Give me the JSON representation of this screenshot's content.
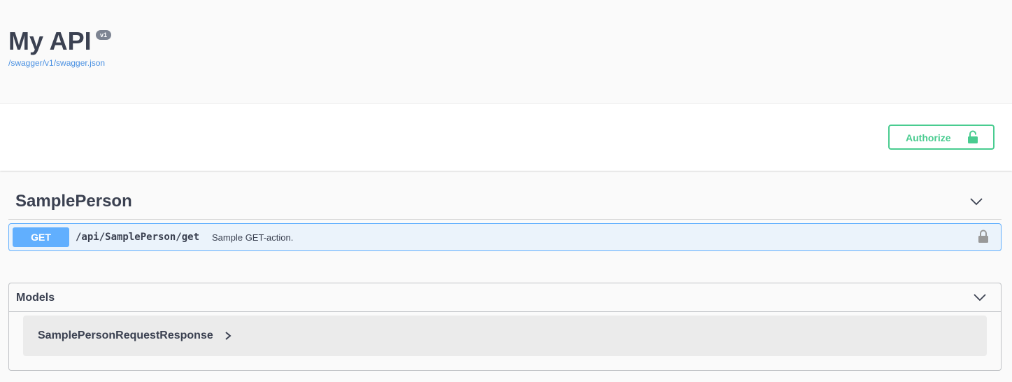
{
  "info": {
    "title": "My API",
    "version": "v1",
    "spec_link": "/swagger/v1/swagger.json"
  },
  "scheme": {
    "authorize_label": "Authorize",
    "lock_icon": "lock-open-icon"
  },
  "tags": [
    {
      "name": "SamplePerson",
      "chevron_icon": "chevron-down-icon",
      "operations": [
        {
          "method": "GET",
          "path": "/api/SamplePerson/get",
          "summary": "Sample GET-action.",
          "lock_icon": "lock-icon"
        }
      ]
    }
  ],
  "models": {
    "title": "Models",
    "chevron_icon": "chevron-down-icon",
    "items": [
      {
        "name": "SamplePersonRequestResponse",
        "expand_icon": "chevron-right-icon"
      }
    ]
  },
  "colors": {
    "accent_green": "#49cc90",
    "get_blue": "#61affe",
    "get_bg": "#ebf3fb",
    "link_blue": "#4990e2",
    "text_dark": "#3b4151",
    "badge_gray": "#7d8492"
  }
}
